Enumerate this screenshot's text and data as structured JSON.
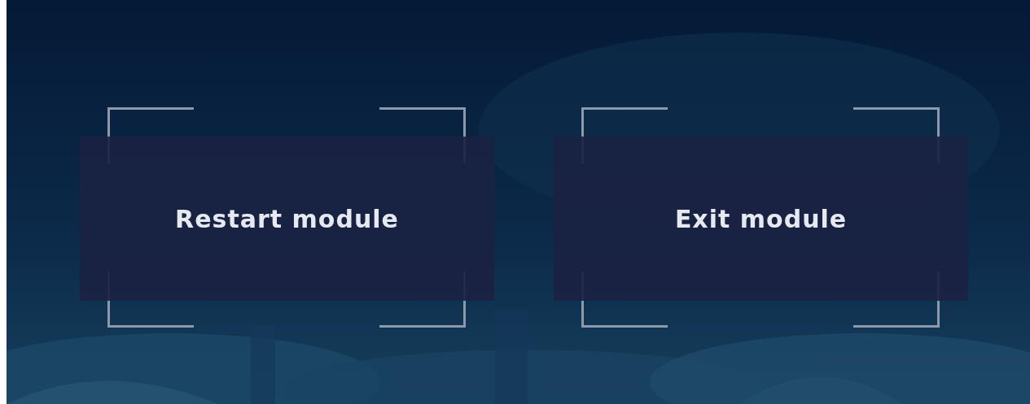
{
  "buttons": [
    {
      "label": "Restart module"
    },
    {
      "label": "Exit module"
    }
  ]
}
